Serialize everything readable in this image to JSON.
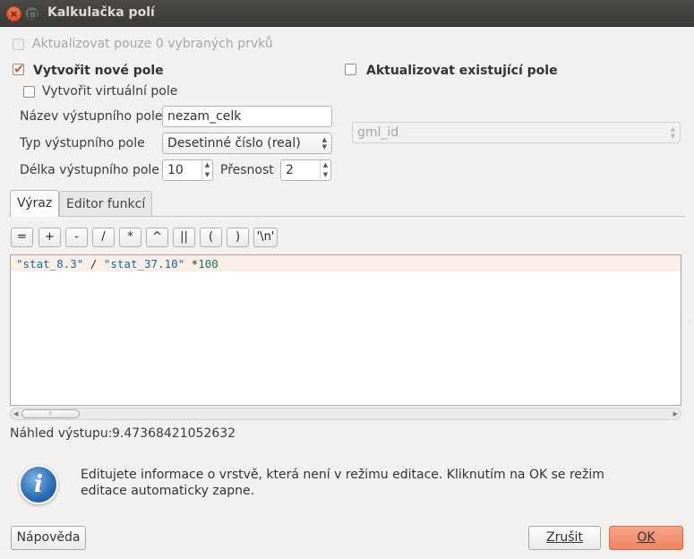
{
  "window": {
    "title": "Kalkulačka polí",
    "close_glyph": "×"
  },
  "update_selected": {
    "label": "Aktualizovat pouze 0 vybraných prvků",
    "checked": false,
    "enabled": false
  },
  "create_new_field": {
    "label": "Vytvořit nové pole",
    "checked": true
  },
  "update_existing": {
    "label": "Aktualizovat existující pole",
    "checked": false
  },
  "create_virtual": {
    "label": "Vytvořit virtuální pole",
    "checked": false
  },
  "output_name": {
    "label": "Název výstupního pole",
    "value": "nezam_celk"
  },
  "output_type": {
    "label": "Typ výstupního pole",
    "value": "Desetinné číslo (real)"
  },
  "output_length": {
    "label": "Délka výstupního pole",
    "value": "10"
  },
  "precision": {
    "label": "Přesnost",
    "value": "2"
  },
  "existing_field_combo": {
    "value": "gml_id"
  },
  "tabs": [
    {
      "label": "Výraz",
      "active": true
    },
    {
      "label": "Editor funkcí",
      "active": false
    }
  ],
  "operators": [
    "=",
    "+",
    "-",
    "/",
    "*",
    "^",
    "||",
    "(",
    ")",
    "'\\n'"
  ],
  "expression": {
    "field1": "\"stat_8.3\"",
    "op1": " / ",
    "field2": "\"stat_37.10\"",
    "op2": " *",
    "number": "100"
  },
  "preview": {
    "label": "Náhled výstupu:",
    "value": "9.47368421052632"
  },
  "info": {
    "text": "Editujete informace o vrstvě, která není v režimu editace. Kliknutím na OK se režim editace automaticky zapne."
  },
  "buttons": {
    "help": "Nápověda",
    "cancel": "Zrušit",
    "ok": "OK"
  },
  "colors": {
    "accent": "#ef8461",
    "check": "#e05a2b",
    "titlebar": "#3b3a37",
    "info_blue": "#2a6ab4"
  }
}
